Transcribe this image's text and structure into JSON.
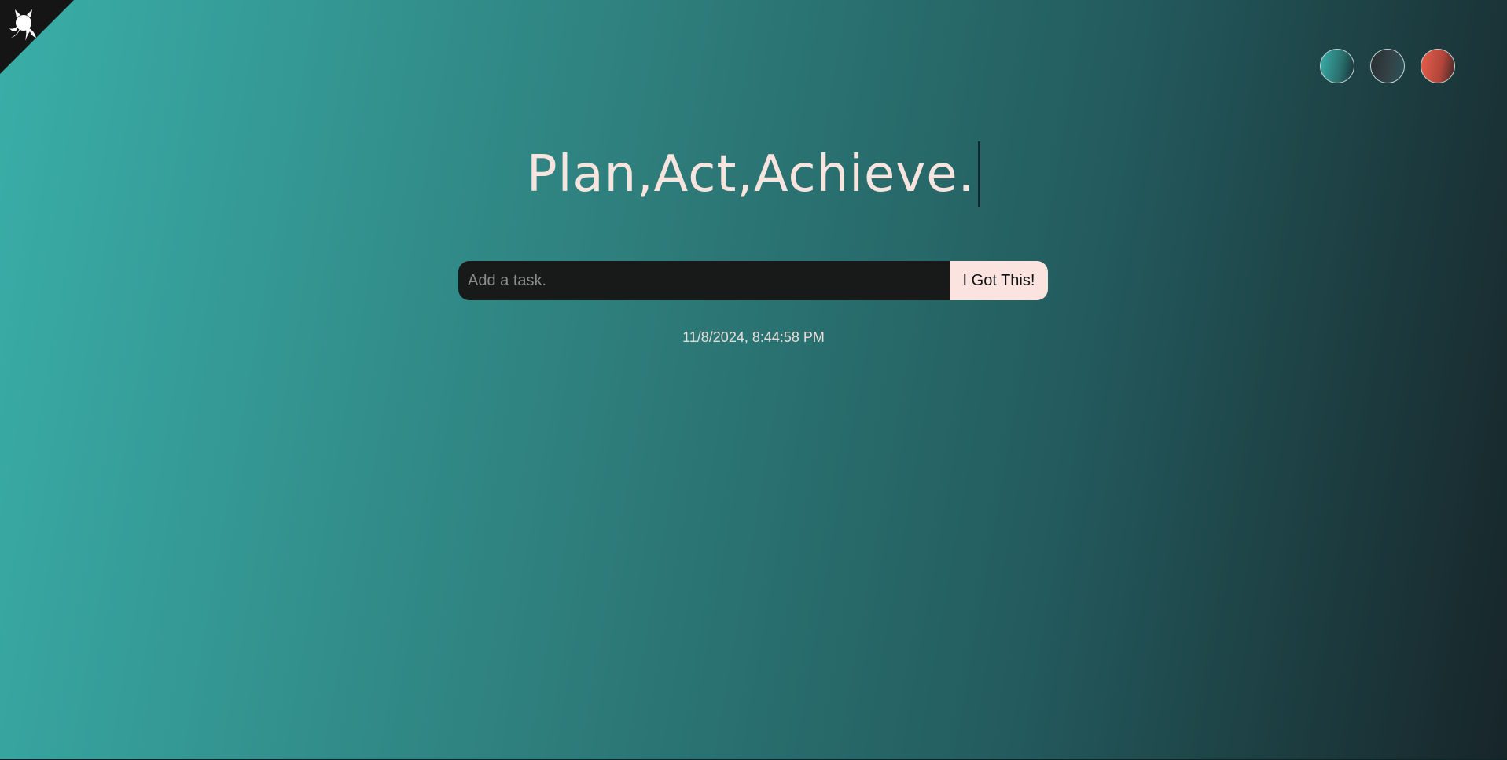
{
  "heading": {
    "text": "Plan,Act,Achieve."
  },
  "task_form": {
    "input_placeholder": "Add a task.",
    "input_value": "",
    "submit_label": "I Got This!"
  },
  "datetime": "11/8/2024, 8:44:58 PM",
  "themes": [
    {
      "name": "standard",
      "icon": "circle"
    },
    {
      "name": "dark",
      "icon": "circle"
    },
    {
      "name": "light",
      "icon": "circle"
    }
  ],
  "github_corner": {
    "icon": "github-octocat-icon"
  },
  "colors": {
    "heading": "#f7e4de",
    "input_bg": "#181a1a",
    "button_bg": "#fbe3e0",
    "gradient_start": "#3aaea8",
    "gradient_end": "#172529"
  }
}
